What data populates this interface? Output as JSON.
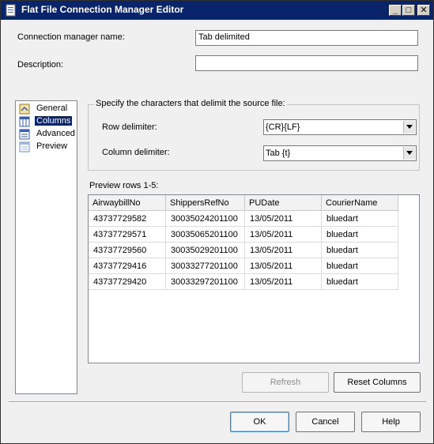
{
  "window": {
    "title": "Flat File Connection Manager Editor"
  },
  "titlebar_buttons": {
    "minimize": "_",
    "maximize": "□",
    "close": "✕"
  },
  "form": {
    "conn_name_label": "Connection manager name:",
    "conn_name_value": "Tab delimited",
    "description_label": "Description:",
    "description_value": ""
  },
  "nav": {
    "items": [
      {
        "label": "General",
        "icon": "general-icon",
        "selected": false
      },
      {
        "label": "Columns",
        "icon": "columns-icon",
        "selected": true
      },
      {
        "label": "Advanced",
        "icon": "advanced-icon",
        "selected": false
      },
      {
        "label": "Preview",
        "icon": "preview-icon",
        "selected": false
      }
    ]
  },
  "delimiters": {
    "group_label": "Specify the characters that delimit the source file:",
    "row_label": "Row delimiter:",
    "row_value": "{CR}{LF}",
    "column_label": "Column delimiter:",
    "column_value": "Tab {t}"
  },
  "preview": {
    "label": "Preview rows 1-5:",
    "columns": [
      "AirwaybillNo",
      "ShippersRefNo",
      "PUDate",
      "CourierName"
    ],
    "rows": [
      [
        "43737729582",
        "30035024201100",
        "13/05/2011",
        "bluedart"
      ],
      [
        "43737729571",
        "30035065201100",
        "13/05/2011",
        "bluedart"
      ],
      [
        "43737729560",
        "30035029201100",
        "13/05/2011",
        "bluedart"
      ],
      [
        "43737729416",
        "30033277201100",
        "13/05/2011",
        "bluedart"
      ],
      [
        "43737729420",
        "30033297201100",
        "13/05/2011",
        "bluedart"
      ]
    ]
  },
  "buttons": {
    "refresh": "Refresh",
    "reset_columns": "Reset Columns",
    "ok": "OK",
    "cancel": "Cancel",
    "help": "Help"
  },
  "colors": {
    "titlebar": "#0a246a",
    "selection": "#0a246a",
    "dialog_bg": "#f0f0f0"
  }
}
